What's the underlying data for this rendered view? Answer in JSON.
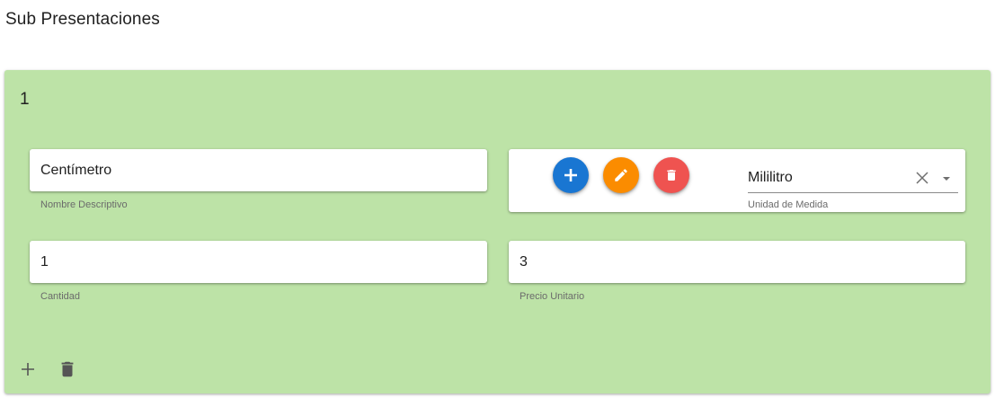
{
  "page": {
    "title": "Sub Presentaciones"
  },
  "card": {
    "number": "1",
    "background_color": "#bde3a7",
    "fields": {
      "name": {
        "value": "Centímetro",
        "hint": "Nombre Descriptivo"
      },
      "unit": {
        "value": "Mililitro",
        "hint": "Unidad de Medida"
      },
      "quantity": {
        "value": "1",
        "hint": "Cantidad"
      },
      "price": {
        "value": "3",
        "hint": "Precio Unitario"
      }
    },
    "unit_actions": [
      {
        "icon": "plus-icon",
        "color": "#1976d2"
      },
      {
        "icon": "pencil-icon",
        "color": "#fb8c00"
      },
      {
        "icon": "trash-icon",
        "color": "#ef5350"
      }
    ],
    "footer_actions": [
      {
        "icon": "plus-icon"
      },
      {
        "icon": "trash-icon"
      }
    ]
  }
}
